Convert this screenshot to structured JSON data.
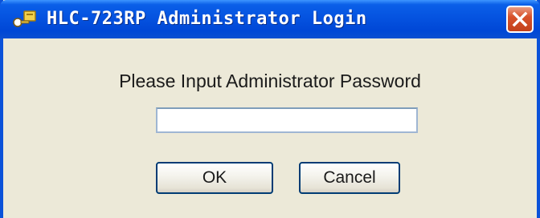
{
  "window": {
    "title": "HLC-723RP Administrator Login",
    "app_icon": "app-key-icon",
    "close_icon": "close-icon"
  },
  "dialog": {
    "prompt": "Please Input Administrator Password",
    "password_value": "",
    "ok_label": "OK",
    "cancel_label": "Cancel"
  },
  "colors": {
    "titlebar_blue": "#0553e0",
    "close_red": "#d8522b",
    "dialog_bg": "#ece9d8"
  }
}
